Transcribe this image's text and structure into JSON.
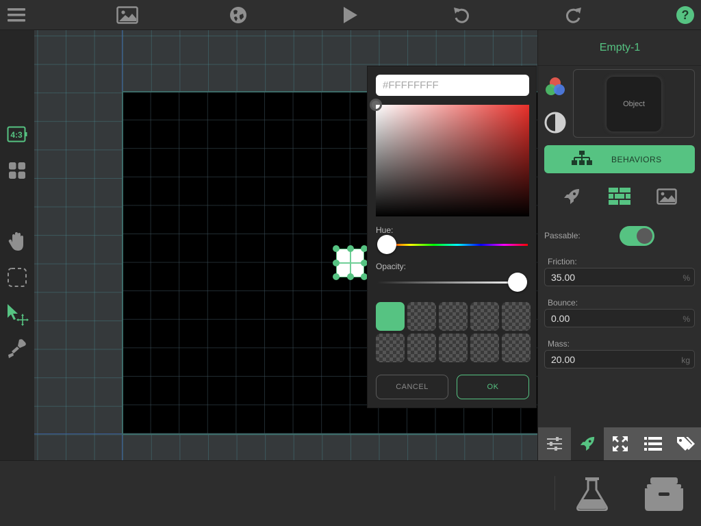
{
  "toolbar": {
    "menu_icon": "hamburger-icon",
    "items": [
      "image-icon",
      "globe-icon",
      "play-icon",
      "undo-icon",
      "redo-icon",
      "help-icon"
    ],
    "help_glyph": "?"
  },
  "left_tools": {
    "aspect_label": "4:3",
    "items": [
      "aspect-ratio-icon",
      "grid-icon",
      "hand-icon",
      "select-box-icon",
      "move-pointer-icon",
      "stamp-icon"
    ]
  },
  "canvas": {
    "selected_object": "Empty-1"
  },
  "color_picker": {
    "hex_value": "#FFFFFFFF",
    "hue_label": "Hue:",
    "opacity_label": "Opacity:",
    "cancel_label": "CANCEL",
    "ok_label": "OK",
    "active_swatch_color": "#56c382",
    "base_hue_color": "#e8302a",
    "hue_fraction": 0.0,
    "opacity_fraction": 1.0
  },
  "properties": {
    "title": "Empty-1",
    "preview_label": "Object",
    "behaviors_label": "BEHAVIORS",
    "passable_label": "Passable:",
    "passable_on": true,
    "friction_label": "Friction:",
    "friction_value": "35.00",
    "friction_unit": "%",
    "bounce_label": "Bounce:",
    "bounce_value": "0.00",
    "bounce_unit": "%",
    "mass_label": "Mass:",
    "mass_value": "20.00",
    "mass_unit": "kg",
    "mini_tabs": [
      "rocket-icon",
      "bricks-icon",
      "image-icon"
    ],
    "bottom_tabs": [
      "sliders-icon",
      "rocket-icon",
      "expand-icon",
      "list-icon",
      "tags-icon"
    ]
  },
  "tray": {
    "items": [
      "flask-icon",
      "inbox-tray-icon"
    ]
  },
  "colors": {
    "accent": "#56c382",
    "accent_dark_text": "#1d3d2a",
    "icon_gray": "#8f8f8f"
  }
}
